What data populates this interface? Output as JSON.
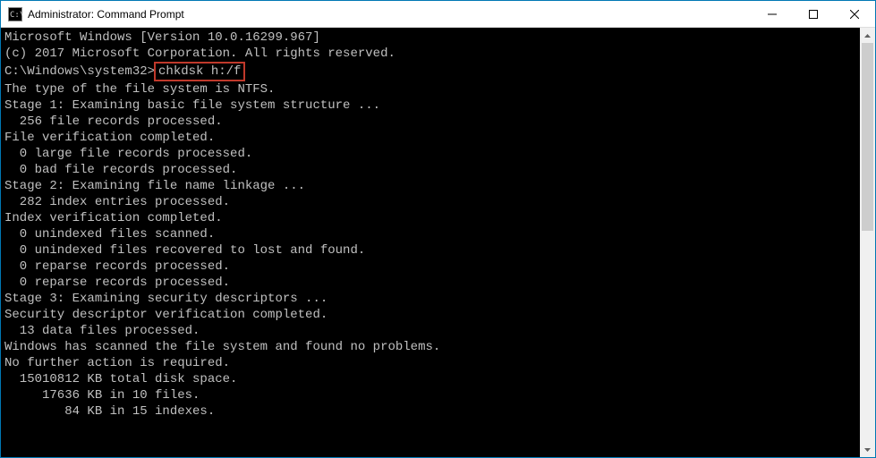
{
  "window": {
    "title": "Administrator: Command Prompt"
  },
  "terminal": {
    "line01": "Microsoft Windows [Version 10.0.16299.967]",
    "line02": "(c) 2017 Microsoft Corporation. All rights reserved.",
    "blank1": "",
    "prompt": "C:\\Windows\\system32>",
    "command": "chkdsk h:/f",
    "line03": "The type of the file system is NTFS.",
    "blank2": "",
    "line04": "Stage 1: Examining basic file system structure ...",
    "line05": "  256 file records processed.",
    "line06": "File verification completed.",
    "line07": "  0 large file records processed.",
    "line08": "  0 bad file records processed.",
    "blank3": "",
    "line09": "Stage 2: Examining file name linkage ...",
    "line10": "  282 index entries processed.",
    "line11": "Index verification completed.",
    "line12": "  0 unindexed files scanned.",
    "line13": "  0 unindexed files recovered to lost and found.",
    "line14": "  0 reparse records processed.",
    "line15": "  0 reparse records processed.",
    "blank4": "",
    "line16": "Stage 3: Examining security descriptors ...",
    "line17": "Security descriptor verification completed.",
    "line18": "  13 data files processed.",
    "blank5": "",
    "line19": "Windows has scanned the file system and found no problems.",
    "line20": "No further action is required.",
    "blank6": "",
    "line21": "  15010812 KB total disk space.",
    "line22": "     17636 KB in 10 files.",
    "line23": "        84 KB in 15 indexes."
  }
}
